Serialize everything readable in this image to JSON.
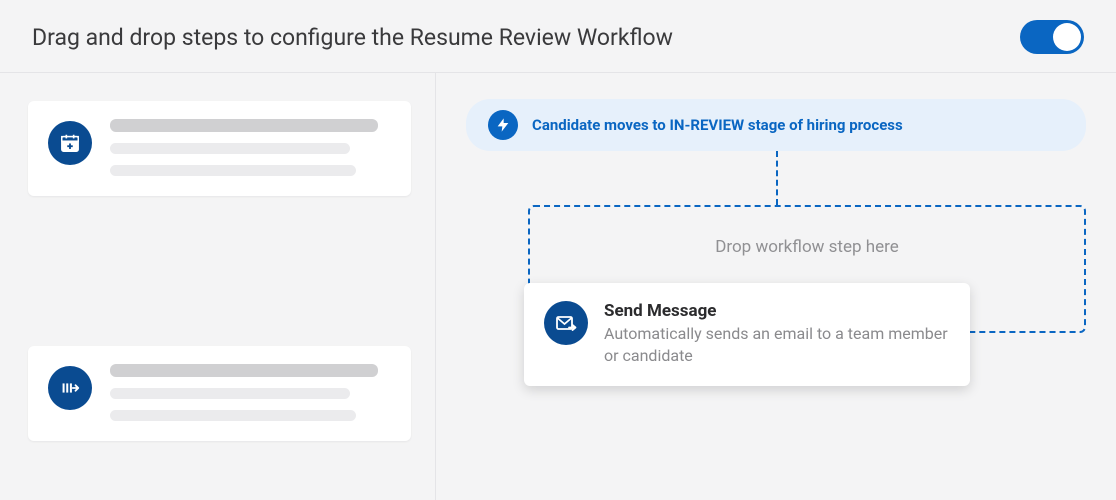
{
  "header": {
    "title": "Drag and drop steps to configure the Resume Review Workflow"
  },
  "toggle": {
    "on": true
  },
  "trigger": {
    "text": "Candidate moves to IN-REVIEW stage of hiring process"
  },
  "drop_zone": {
    "placeholder": "Drop workflow step here"
  },
  "dragging_card": {
    "title": "Send Message",
    "description": "Automatically sends an email to a team member or candidate"
  },
  "icons": {
    "trigger": "bolt-icon",
    "send_message": "mail-forward-icon",
    "calendar_add": "calendar-plus-icon",
    "move_stage": "bars-arrow-icon"
  },
  "colors": {
    "brand": "#0a66c2",
    "brand_dark": "#0a4b91",
    "trigger_bg": "#e6f0fb"
  }
}
